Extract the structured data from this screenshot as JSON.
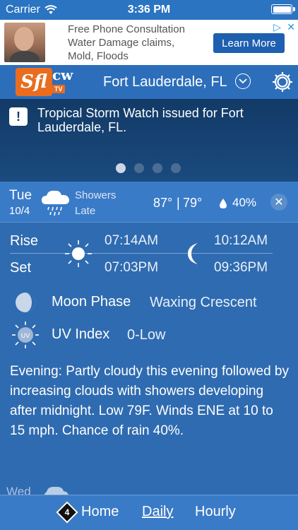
{
  "status_bar": {
    "carrier": "Carrier",
    "time": "3:36 PM"
  },
  "ad": {
    "lines": [
      "Free Phone Consultation",
      "Water Damage claims,",
      "Mold, Floods"
    ],
    "button": "Learn More",
    "adchoices_icon": "adchoices-icon",
    "close_icon": "close-icon"
  },
  "header": {
    "logo_main": "Sfl",
    "logo_cw": "cw",
    "logo_tv": "TV",
    "location": "Fort Lauderdale, FL"
  },
  "alert": {
    "message": "Tropical Storm Watch issued for Fort Lauderdale, FL.",
    "pages": 4,
    "active_page": 1
  },
  "day": {
    "name": "Tue",
    "date": "10/4",
    "condition_line1": "Showers",
    "condition_line2": "Late",
    "high": "87°",
    "separator": "|",
    "low": "79°",
    "precip": "40%"
  },
  "detail": {
    "rise_label": "Rise",
    "set_label": "Set",
    "sunrise": "07:14AM",
    "sunset": "07:03PM",
    "moonrise": "10:12AM",
    "moonset": "09:36PM",
    "moon_phase_label": "Moon Phase",
    "moon_phase_value": "Waxing Crescent",
    "uv_label": "UV Index",
    "uv_value": "0-Low",
    "uv_icon_text": "UV",
    "forecast": "Evening: Partly cloudy this evening followed by increasing clouds with showers developing after midnight. Low 79F. Winds ENE at 10 to 15 mph. Chance of rain 40%."
  },
  "next_day": {
    "name": "Wed"
  },
  "bottom_nav": {
    "badge": "4",
    "home": "Home",
    "daily": "Daily",
    "hourly": "Hourly"
  },
  "colors": {
    "header_blue": "#2d6ebb",
    "alert_navy": "#123a66",
    "detail_blue": "#2f6bb0",
    "logo_orange": "#e96c1f",
    "ad_button_blue": "#1f5fb0"
  }
}
